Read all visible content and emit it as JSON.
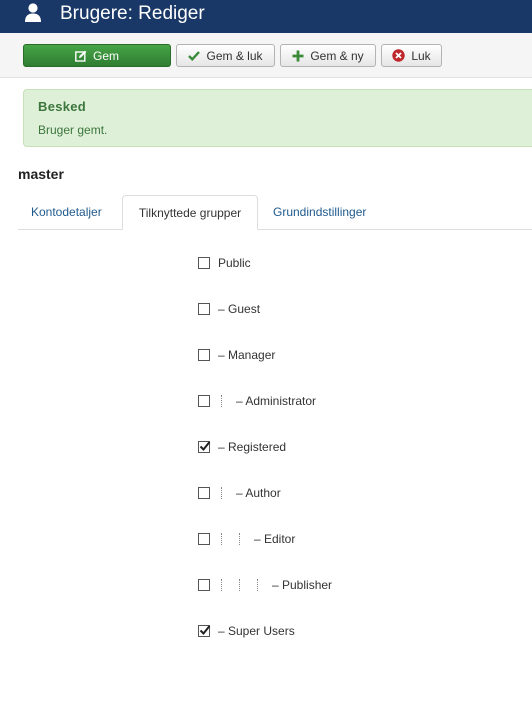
{
  "header": {
    "title": "Brugere: Rediger",
    "icon": "user-icon",
    "background": "#1a3867"
  },
  "toolbar": {
    "save_label": "Gem",
    "save_close_label": "Gem & luk",
    "save_new_label": "Gem & ny",
    "close_label": "Luk"
  },
  "message": {
    "heading": "Besked",
    "text": "Bruger gemt."
  },
  "user": {
    "name": "master"
  },
  "tabs": [
    {
      "label": "Kontodetaljer",
      "active": false
    },
    {
      "label": "Tilknyttede grupper",
      "active": true
    },
    {
      "label": "Grundindstillinger",
      "active": false
    }
  ],
  "groups": [
    {
      "label": "Public",
      "checked": false,
      "level": 0
    },
    {
      "label": "– Guest",
      "checked": false,
      "level": 0
    },
    {
      "label": "– Manager",
      "checked": false,
      "level": 0
    },
    {
      "label": "– Administrator",
      "checked": false,
      "level": 1
    },
    {
      "label": "– Registered",
      "checked": true,
      "level": 0
    },
    {
      "label": "– Author",
      "checked": false,
      "level": 1
    },
    {
      "label": "– Editor",
      "checked": false,
      "level": 2
    },
    {
      "label": "– Publisher",
      "checked": false,
      "level": 3
    },
    {
      "label": "– Super Users",
      "checked": true,
      "level": 0
    }
  ]
}
